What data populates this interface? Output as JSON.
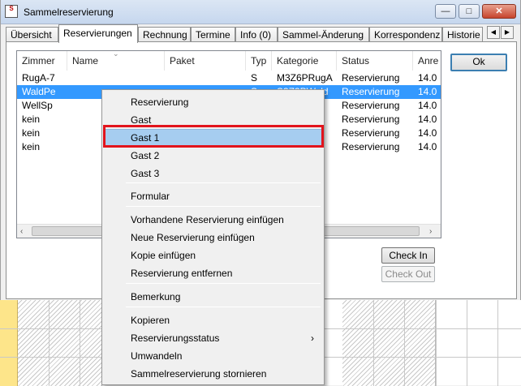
{
  "window": {
    "title": "Sammelreservierung",
    "app_icon_label": "S",
    "minimize_icon": "minimize-icon",
    "maximize_icon": "maximize-icon",
    "close_icon": "close-icon"
  },
  "tabs": [
    {
      "label": "Übersicht"
    },
    {
      "label": "Reservierungen",
      "active": true
    },
    {
      "label": "Rechnung"
    },
    {
      "label": "Termine"
    },
    {
      "label": "Info (0)"
    },
    {
      "label": "Sammel-Änderung"
    },
    {
      "label": "Korrespondenz"
    },
    {
      "label": "Historie"
    }
  ],
  "tab_scroll": {
    "left": "◀",
    "right": "▶"
  },
  "list": {
    "columns": [
      "Zimmer",
      "Name",
      "Paket",
      "Typ",
      "Kategorie",
      "Status",
      "Anre"
    ],
    "rows": [
      [
        "RugA-7",
        "",
        "",
        "S",
        "M3Z6PRugA",
        "Reservierung",
        "14.0"
      ],
      [
        "WaldPe",
        "",
        "",
        "S",
        "S3Z3PWald",
        "Reservierung",
        "14.0"
      ],
      [
        "WellSp",
        "",
        "",
        "",
        "",
        "Reservierung",
        "14.0"
      ],
      [
        "kein",
        "",
        "",
        "",
        "",
        "Reservierung",
        "14.0"
      ],
      [
        "kein",
        "",
        "",
        "",
        "",
        "Reservierung",
        "14.0"
      ],
      [
        "kein",
        "",
        "",
        "",
        "",
        "Reservierung",
        "14.0"
      ]
    ],
    "selected_row": 1
  },
  "buttons": {
    "ok": "Ok",
    "check_in": "Check In",
    "check_out": "Check Out"
  },
  "context_menu": {
    "items": [
      "Reservierung",
      "Gast",
      "Gast 1",
      "Gast 2",
      "Gast 3",
      "Formular",
      "Vorhandene Reservierung einfügen",
      "Neue Reservierung einfügen",
      "Kopie einfügen",
      "Reservierung entfernen",
      "Bemerkung",
      "Kopieren",
      "Reservierungsstatus",
      "Umwandeln",
      "Sammelreservierung stornieren"
    ],
    "highlighted": "Gast 1",
    "submenu_arrow": "›"
  },
  "colors": {
    "selection": "#3399ff",
    "menu_highlight": "#a6cdf0",
    "annotation": "#e2141c"
  }
}
